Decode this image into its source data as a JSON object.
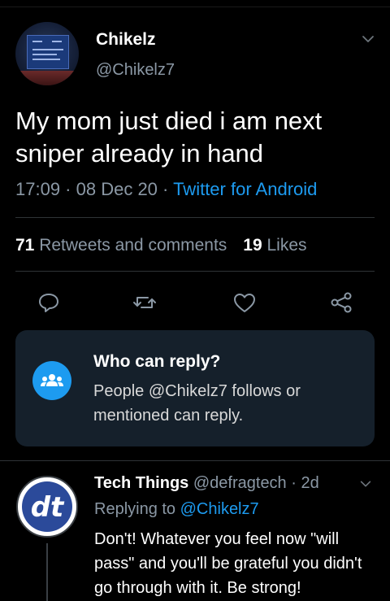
{
  "tweet": {
    "author_name": "Chikelz",
    "author_handle": "@Chikelz7",
    "text": "My mom just died i am next sniper already in hand",
    "time": "17:09",
    "dot1": " · ",
    "date": "08 Dec 20",
    "dot2": " · ",
    "source": "Twitter for Android"
  },
  "stats": {
    "retweets_count": "71",
    "retweets_label": " Retweets and comments",
    "likes_count": "19",
    "likes_label": " Likes"
  },
  "actions": [
    "reply-icon",
    "retweet-icon",
    "like-icon",
    "share-icon"
  ],
  "reply_restriction": {
    "title": "Who can reply?",
    "body": "People @Chikelz7 follows or mentioned can reply."
  },
  "reply": {
    "name": "Tech Things",
    "handle": " @defragtech",
    "dot": " · ",
    "age": "2d",
    "replying_label": "Replying to ",
    "replying_mention": "@Chikelz7",
    "text": "Don't! Whatever you feel now \"will pass\" and you'll be grateful you didn't go through with it. Be strong!",
    "avatar_text": "dt"
  },
  "colors": {
    "background": "#000000",
    "accent": "#1d9bf0",
    "muted": "#8b98a5",
    "card": "#15202b"
  }
}
